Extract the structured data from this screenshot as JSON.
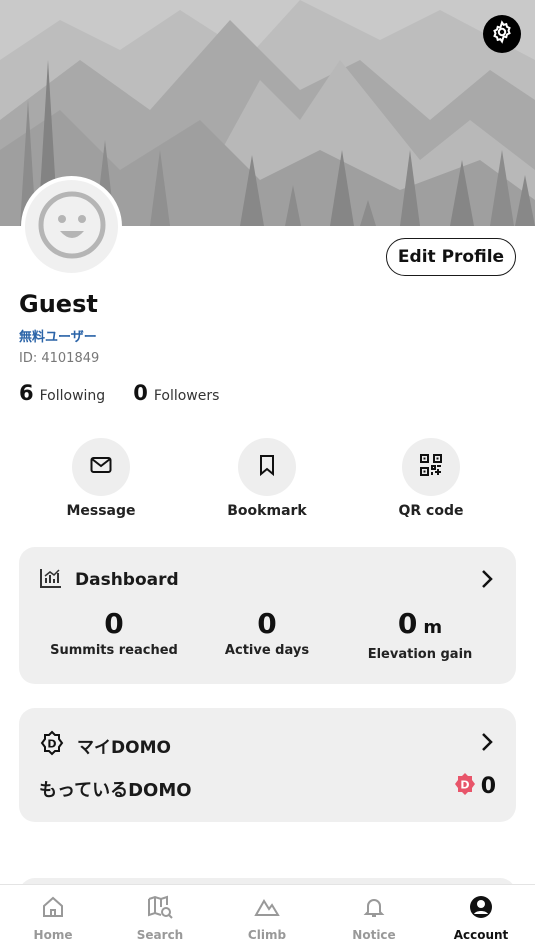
{
  "header": {
    "settings_icon": "gear-icon"
  },
  "profile": {
    "avatar_icon": "smiley-face-icon",
    "edit_label": "Edit Profile",
    "name": "Guest",
    "user_type": "無料ユーザー",
    "id_text": "ID: 4101849",
    "following_count": "6",
    "following_label": "Following",
    "followers_count": "0",
    "followers_label": "Followers"
  },
  "actions": [
    {
      "label": "Message",
      "icon": "envelope-icon"
    },
    {
      "label": "Bookmark",
      "icon": "bookmark-icon"
    },
    {
      "label": "QR code",
      "icon": "qr-code-icon"
    }
  ],
  "dashboard": {
    "title": "Dashboard",
    "icon": "chart-icon",
    "stats": [
      {
        "value": "0",
        "unit": "",
        "label": "Summits reached"
      },
      {
        "value": "0",
        "unit": "",
        "label": "Active days"
      },
      {
        "value": "0",
        "unit": "m",
        "label": "Elevation gain"
      }
    ]
  },
  "domo": {
    "title": "マイDOMO",
    "icon": "domo-badge-icon",
    "have_label": "もっているDOMO",
    "count": "0"
  },
  "tabs": [
    {
      "label": "Home",
      "icon": "home-icon",
      "active": false
    },
    {
      "label": "Search",
      "icon": "map-search-icon",
      "active": false
    },
    {
      "label": "Climb",
      "icon": "mountain-icon",
      "active": false
    },
    {
      "label": "Notice",
      "icon": "bell-icon",
      "active": false
    },
    {
      "label": "Account",
      "icon": "account-icon",
      "active": true
    }
  ],
  "colors": {
    "accent_blue": "#2b64a8",
    "card_bg": "#efefef",
    "domo_pink": "#e8556a",
    "tab_inactive": "#999999"
  }
}
